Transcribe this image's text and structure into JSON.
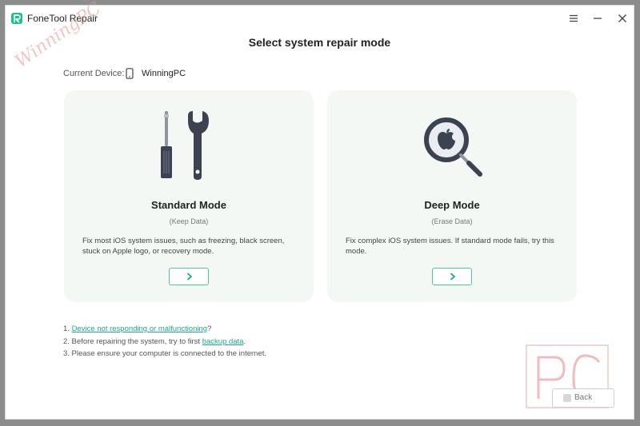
{
  "window": {
    "title": "FoneTool Repair",
    "controls": [
      "menu-icon",
      "minimize-icon",
      "close-icon"
    ]
  },
  "page": {
    "title": "Select system repair mode",
    "current_device_label": "Current Device:",
    "device_name": "WinningPC"
  },
  "modes": [
    {
      "title": "Standard Mode",
      "subtitle": "(Keep Data)",
      "description": "Fix most iOS system issues, such as freezing, black screen, stuck on Apple logo, or recovery mode.",
      "icon": "tools-icon"
    },
    {
      "title": "Deep Mode",
      "subtitle": "(Erase Data)",
      "description": "Fix complex iOS system issues. If standard mode fails, try this mode.",
      "icon": "apple-magnifier-icon"
    }
  ],
  "tips": {
    "t1_prefix": "1. ",
    "t1_link": "Device not responding or malfunctioning",
    "t1_suffix": "?",
    "t2_prefix": "2. Before repairing the system, try to first ",
    "t2_link": "backup data",
    "t2_suffix": ".",
    "t3": "3. Please ensure your computer is connected to the internet."
  },
  "footer": {
    "back_label": "Back"
  },
  "watermark": {
    "text": "WinningPC",
    "badge": "PC"
  },
  "colors": {
    "accent": "#17C38A",
    "card_bg": "#F3F8F5",
    "link": "#17B07F"
  }
}
